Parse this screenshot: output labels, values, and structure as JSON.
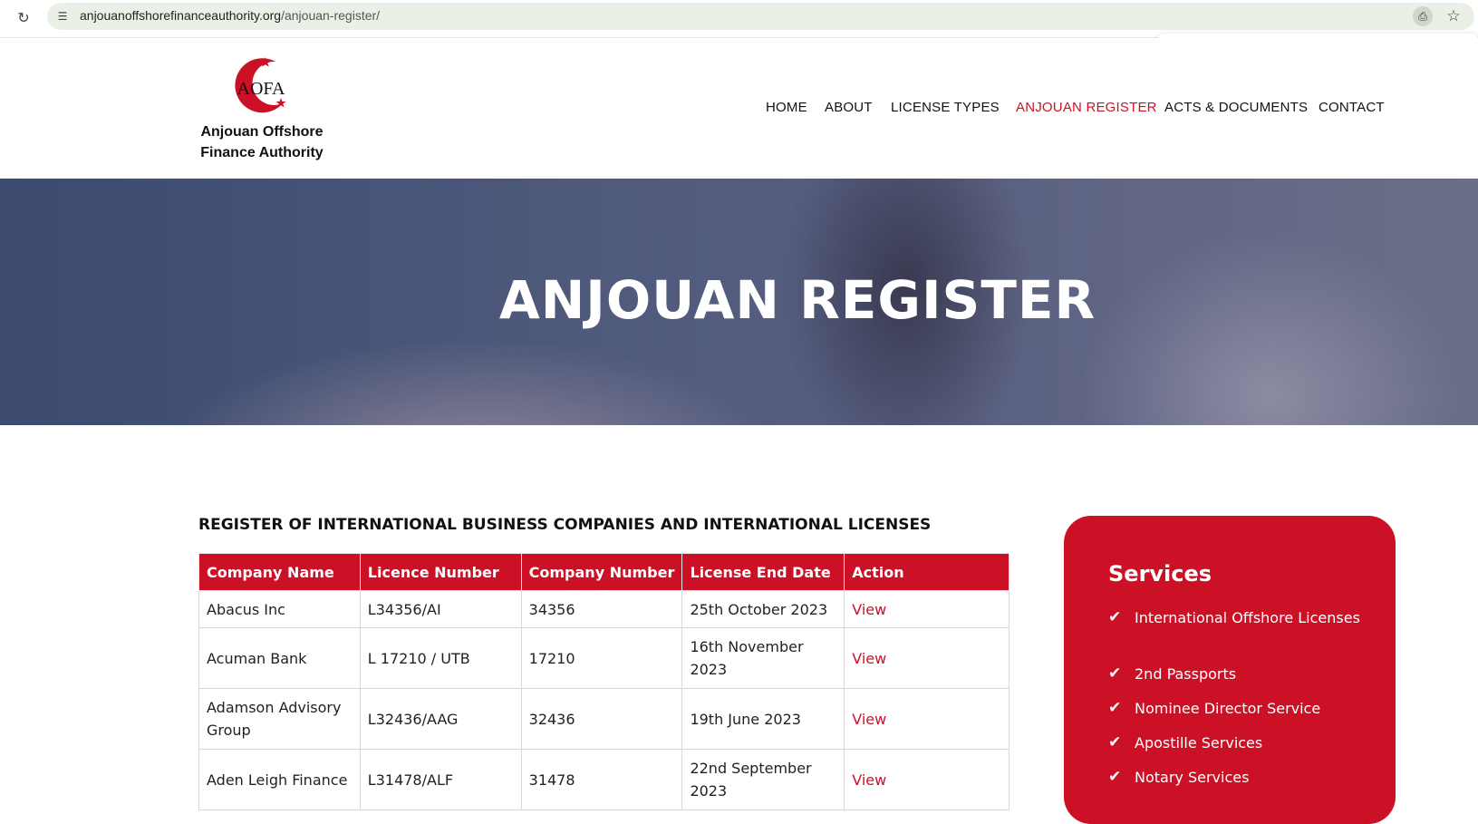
{
  "browser": {
    "url_domain": "anjouanoffshorefinanceauthority.org",
    "url_path": "/anjouan-register/",
    "find_query": ""
  },
  "logo": {
    "mark_text": "AOFA",
    "name_line1": "Anjouan Offshore",
    "name_line2": "Finance Authority"
  },
  "nav": {
    "items": [
      "HOME",
      "ABOUT",
      "LICENSE TYPES",
      "ANJOUAN REGISTER",
      "ACTS & DOCUMENTS",
      "CONTACT"
    ],
    "active": "ANJOUAN REGISTER"
  },
  "hero": {
    "title": "ANJOUAN REGISTER"
  },
  "register": {
    "title": "REGISTER OF INTERNATIONAL BUSINESS COMPANIES AND INTERNATIONAL LICENSES",
    "columns": [
      "Company Name",
      "Licence Number",
      "Company Number",
      "License End Date",
      "Action"
    ],
    "rows": [
      [
        "Abacus Inc",
        "L34356/AI",
        "34356",
        "25th October 2023",
        "View"
      ],
      [
        "Acuman Bank",
        "L 17210 / UTB",
        "17210",
        "16th November 2023",
        "View"
      ],
      [
        "Adamson Advisory Group",
        "L32436/AAG",
        "32436",
        "19th June 2023",
        "View"
      ],
      [
        "Aden Leigh Finance",
        "L31478/ALF",
        "31478",
        "22nd September 2023",
        "View"
      ]
    ]
  },
  "services": {
    "title": "Services",
    "items": [
      "International Offshore Licenses",
      "2nd Passports",
      "Nominee Director Service",
      "Apostille Services",
      "Notary Services"
    ]
  },
  "colors": {
    "brand_red": "#cc1126",
    "hero_blue": "#3c4a6f"
  }
}
